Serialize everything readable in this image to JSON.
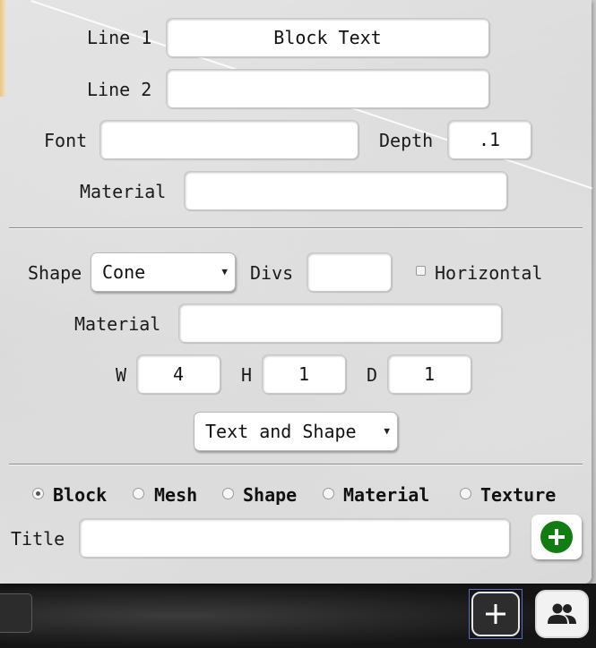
{
  "text_block": {
    "line1_label": "Line 1",
    "line1_value": "Block Text",
    "line2_label": "Line 2",
    "line2_value": "",
    "font_label": "Font",
    "font_value": "",
    "depth_label": "Depth",
    "depth_value": ".1",
    "material_label": "Material",
    "material_value": ""
  },
  "shape_block": {
    "shape_label": "Shape",
    "shape_selected": "Cone",
    "divs_label": "Divs",
    "divs_value": "",
    "horizontal_label": "Horizontal",
    "horizontal_checked": false,
    "material_label": "Material",
    "material_value": "",
    "w_label": "W",
    "w_value": "4",
    "h_label": "H",
    "h_value": "1",
    "d_label": "D",
    "d_value": "1",
    "mode_selected": "Text and Shape"
  },
  "type_selector": {
    "options": [
      "Block",
      "Mesh",
      "Shape",
      "Material",
      "Texture"
    ],
    "selected": "Block"
  },
  "title_row": {
    "label": "Title",
    "value": ""
  },
  "colors": {
    "add_button": "#0f7d0f",
    "focus_border": "#5570b8"
  },
  "icons": {
    "add_asset": "plus-circle-icon",
    "add": "plus-icon",
    "users": "people-icon"
  }
}
